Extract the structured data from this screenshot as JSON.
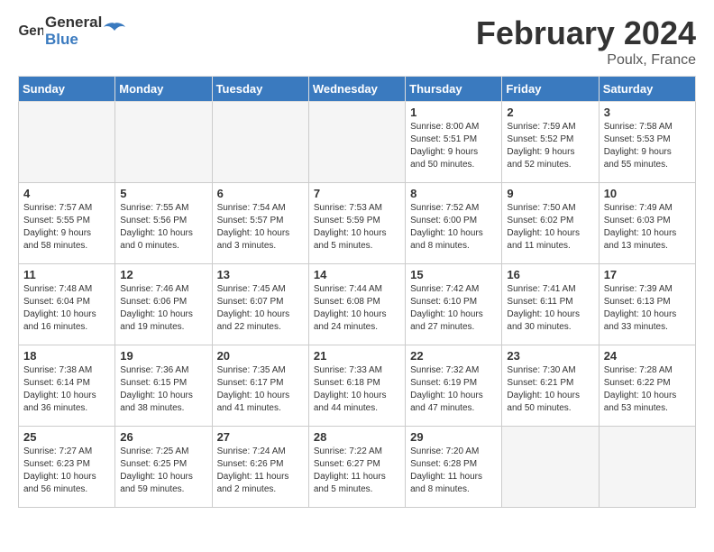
{
  "header": {
    "logo_general": "General",
    "logo_blue": "Blue",
    "title": "February 2024",
    "subtitle": "Poulx, France"
  },
  "weekdays": [
    "Sunday",
    "Monday",
    "Tuesday",
    "Wednesday",
    "Thursday",
    "Friday",
    "Saturday"
  ],
  "weeks": [
    [
      {
        "day": "",
        "info": ""
      },
      {
        "day": "",
        "info": ""
      },
      {
        "day": "",
        "info": ""
      },
      {
        "day": "",
        "info": ""
      },
      {
        "day": "1",
        "info": "Sunrise: 8:00 AM\nSunset: 5:51 PM\nDaylight: 9 hours\nand 50 minutes."
      },
      {
        "day": "2",
        "info": "Sunrise: 7:59 AM\nSunset: 5:52 PM\nDaylight: 9 hours\nand 52 minutes."
      },
      {
        "day": "3",
        "info": "Sunrise: 7:58 AM\nSunset: 5:53 PM\nDaylight: 9 hours\nand 55 minutes."
      }
    ],
    [
      {
        "day": "4",
        "info": "Sunrise: 7:57 AM\nSunset: 5:55 PM\nDaylight: 9 hours\nand 58 minutes."
      },
      {
        "day": "5",
        "info": "Sunrise: 7:55 AM\nSunset: 5:56 PM\nDaylight: 10 hours\nand 0 minutes."
      },
      {
        "day": "6",
        "info": "Sunrise: 7:54 AM\nSunset: 5:57 PM\nDaylight: 10 hours\nand 3 minutes."
      },
      {
        "day": "7",
        "info": "Sunrise: 7:53 AM\nSunset: 5:59 PM\nDaylight: 10 hours\nand 5 minutes."
      },
      {
        "day": "8",
        "info": "Sunrise: 7:52 AM\nSunset: 6:00 PM\nDaylight: 10 hours\nand 8 minutes."
      },
      {
        "day": "9",
        "info": "Sunrise: 7:50 AM\nSunset: 6:02 PM\nDaylight: 10 hours\nand 11 minutes."
      },
      {
        "day": "10",
        "info": "Sunrise: 7:49 AM\nSunset: 6:03 PM\nDaylight: 10 hours\nand 13 minutes."
      }
    ],
    [
      {
        "day": "11",
        "info": "Sunrise: 7:48 AM\nSunset: 6:04 PM\nDaylight: 10 hours\nand 16 minutes."
      },
      {
        "day": "12",
        "info": "Sunrise: 7:46 AM\nSunset: 6:06 PM\nDaylight: 10 hours\nand 19 minutes."
      },
      {
        "day": "13",
        "info": "Sunrise: 7:45 AM\nSunset: 6:07 PM\nDaylight: 10 hours\nand 22 minutes."
      },
      {
        "day": "14",
        "info": "Sunrise: 7:44 AM\nSunset: 6:08 PM\nDaylight: 10 hours\nand 24 minutes."
      },
      {
        "day": "15",
        "info": "Sunrise: 7:42 AM\nSunset: 6:10 PM\nDaylight: 10 hours\nand 27 minutes."
      },
      {
        "day": "16",
        "info": "Sunrise: 7:41 AM\nSunset: 6:11 PM\nDaylight: 10 hours\nand 30 minutes."
      },
      {
        "day": "17",
        "info": "Sunrise: 7:39 AM\nSunset: 6:13 PM\nDaylight: 10 hours\nand 33 minutes."
      }
    ],
    [
      {
        "day": "18",
        "info": "Sunrise: 7:38 AM\nSunset: 6:14 PM\nDaylight: 10 hours\nand 36 minutes."
      },
      {
        "day": "19",
        "info": "Sunrise: 7:36 AM\nSunset: 6:15 PM\nDaylight: 10 hours\nand 38 minutes."
      },
      {
        "day": "20",
        "info": "Sunrise: 7:35 AM\nSunset: 6:17 PM\nDaylight: 10 hours\nand 41 minutes."
      },
      {
        "day": "21",
        "info": "Sunrise: 7:33 AM\nSunset: 6:18 PM\nDaylight: 10 hours\nand 44 minutes."
      },
      {
        "day": "22",
        "info": "Sunrise: 7:32 AM\nSunset: 6:19 PM\nDaylight: 10 hours\nand 47 minutes."
      },
      {
        "day": "23",
        "info": "Sunrise: 7:30 AM\nSunset: 6:21 PM\nDaylight: 10 hours\nand 50 minutes."
      },
      {
        "day": "24",
        "info": "Sunrise: 7:28 AM\nSunset: 6:22 PM\nDaylight: 10 hours\nand 53 minutes."
      }
    ],
    [
      {
        "day": "25",
        "info": "Sunrise: 7:27 AM\nSunset: 6:23 PM\nDaylight: 10 hours\nand 56 minutes."
      },
      {
        "day": "26",
        "info": "Sunrise: 7:25 AM\nSunset: 6:25 PM\nDaylight: 10 hours\nand 59 minutes."
      },
      {
        "day": "27",
        "info": "Sunrise: 7:24 AM\nSunset: 6:26 PM\nDaylight: 11 hours\nand 2 minutes."
      },
      {
        "day": "28",
        "info": "Sunrise: 7:22 AM\nSunset: 6:27 PM\nDaylight: 11 hours\nand 5 minutes."
      },
      {
        "day": "29",
        "info": "Sunrise: 7:20 AM\nSunset: 6:28 PM\nDaylight: 11 hours\nand 8 minutes."
      },
      {
        "day": "",
        "info": ""
      },
      {
        "day": "",
        "info": ""
      }
    ]
  ]
}
